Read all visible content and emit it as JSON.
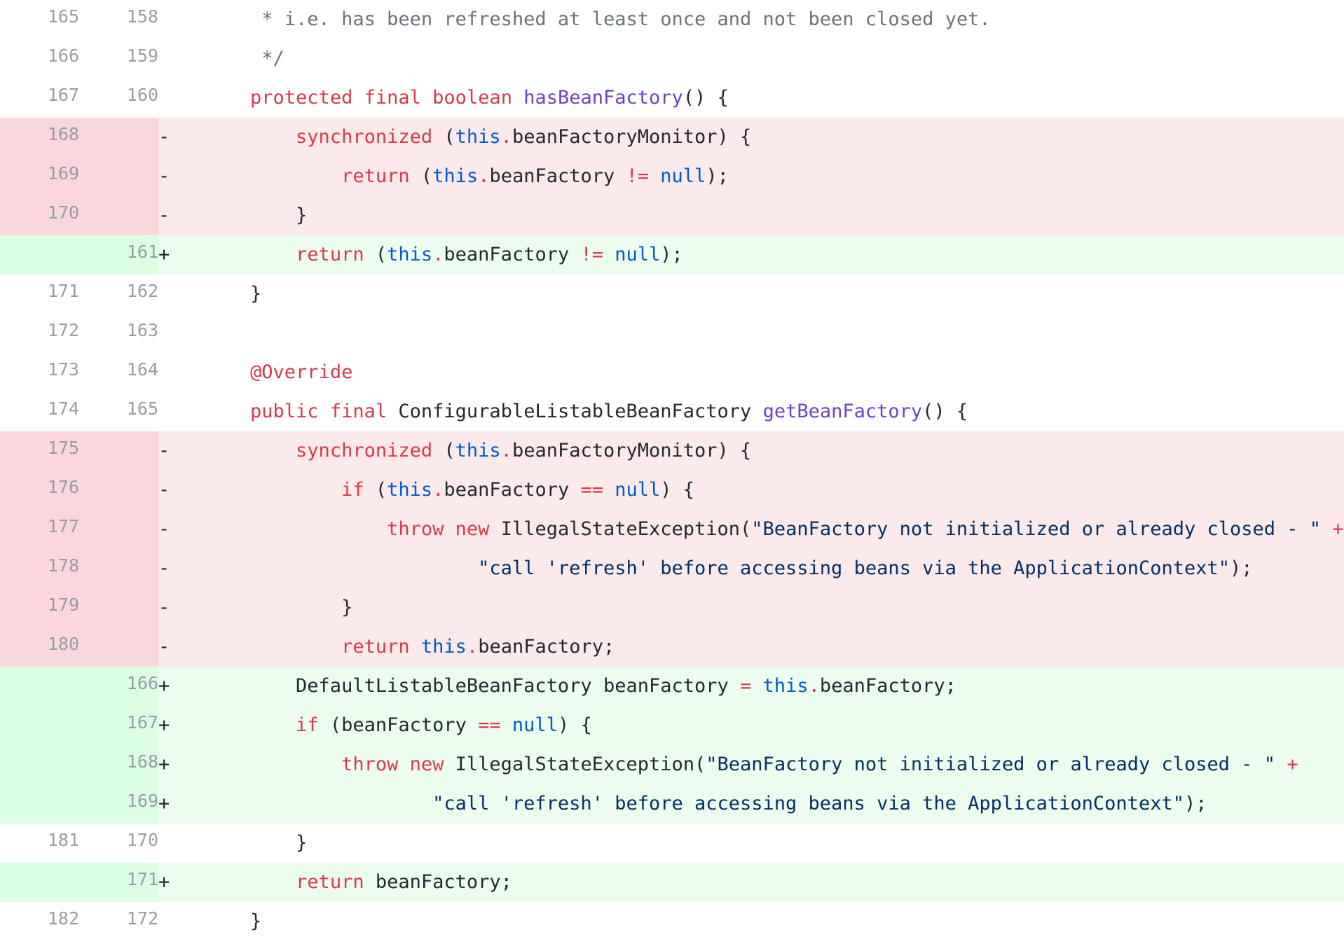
{
  "colors": {
    "background": "#ffffff",
    "line_number": "#959da5",
    "deleted_gutter": "#f9d7dc",
    "deleted_line": "#fbe9eb",
    "added_gutter": "#dcffe4",
    "added_line": "#ecfdf0",
    "keyword": "#d73a49",
    "function": "#6f42c1",
    "constant": "#005cc5",
    "string": "#032f62",
    "comment": "#6a737d",
    "text": "#24292e"
  },
  "diff": {
    "lines": [
      {
        "kind": "ctx",
        "old": "165",
        "new": "158",
        "marker": "",
        "tokens": [
          {
            "t": "cm",
            "v": "     * i.e. has been refreshed at least once and not been closed yet."
          }
        ]
      },
      {
        "kind": "ctx",
        "old": "166",
        "new": "159",
        "marker": "",
        "tokens": [
          {
            "t": "cm",
            "v": "     */"
          }
        ]
      },
      {
        "kind": "ctx",
        "old": "167",
        "new": "160",
        "marker": "",
        "tokens": [
          {
            "t": "p",
            "v": "    "
          },
          {
            "t": "kw",
            "v": "protected"
          },
          {
            "t": "p",
            "v": " "
          },
          {
            "t": "kw",
            "v": "final"
          },
          {
            "t": "p",
            "v": " "
          },
          {
            "t": "kw",
            "v": "boolean"
          },
          {
            "t": "p",
            "v": " "
          },
          {
            "t": "fn",
            "v": "hasBeanFactory"
          },
          {
            "t": "p",
            "v": "() {"
          }
        ]
      },
      {
        "kind": "del",
        "old": "168",
        "new": "",
        "marker": "-",
        "tokens": [
          {
            "t": "p",
            "v": "        "
          },
          {
            "t": "kw",
            "v": "synchronized"
          },
          {
            "t": "p",
            "v": " ("
          },
          {
            "t": "c",
            "v": "this"
          },
          {
            "t": "kw",
            "v": "."
          },
          {
            "t": "p",
            "v": "beanFactoryMonitor) {"
          }
        ]
      },
      {
        "kind": "del",
        "old": "169",
        "new": "",
        "marker": "-",
        "tokens": [
          {
            "t": "p",
            "v": "            "
          },
          {
            "t": "kw",
            "v": "return"
          },
          {
            "t": "p",
            "v": " ("
          },
          {
            "t": "c",
            "v": "this"
          },
          {
            "t": "kw",
            "v": "."
          },
          {
            "t": "p",
            "v": "beanFactory "
          },
          {
            "t": "kw",
            "v": "!="
          },
          {
            "t": "p",
            "v": " "
          },
          {
            "t": "c",
            "v": "null"
          },
          {
            "t": "p",
            "v": ");"
          }
        ]
      },
      {
        "kind": "del",
        "old": "170",
        "new": "",
        "marker": "-",
        "tokens": [
          {
            "t": "p",
            "v": "        }"
          }
        ]
      },
      {
        "kind": "add",
        "old": "",
        "new": "161",
        "marker": "+",
        "tokens": [
          {
            "t": "p",
            "v": "        "
          },
          {
            "t": "kw",
            "v": "return"
          },
          {
            "t": "p",
            "v": " ("
          },
          {
            "t": "c",
            "v": "this"
          },
          {
            "t": "kw",
            "v": "."
          },
          {
            "t": "p",
            "v": "beanFactory "
          },
          {
            "t": "kw",
            "v": "!="
          },
          {
            "t": "p",
            "v": " "
          },
          {
            "t": "c",
            "v": "null"
          },
          {
            "t": "p",
            "v": ");"
          }
        ]
      },
      {
        "kind": "ctx",
        "old": "171",
        "new": "162",
        "marker": "",
        "tokens": [
          {
            "t": "p",
            "v": "    }"
          }
        ]
      },
      {
        "kind": "ctx",
        "old": "172",
        "new": "163",
        "marker": "",
        "tokens": []
      },
      {
        "kind": "ctx",
        "old": "173",
        "new": "164",
        "marker": "",
        "tokens": [
          {
            "t": "p",
            "v": "    "
          },
          {
            "t": "kw",
            "v": "@Override"
          }
        ]
      },
      {
        "kind": "ctx",
        "old": "174",
        "new": "165",
        "marker": "",
        "tokens": [
          {
            "t": "p",
            "v": "    "
          },
          {
            "t": "kw",
            "v": "public"
          },
          {
            "t": "p",
            "v": " "
          },
          {
            "t": "kw",
            "v": "final"
          },
          {
            "t": "p",
            "v": " ConfigurableListableBeanFactory "
          },
          {
            "t": "fn",
            "v": "getBeanFactory"
          },
          {
            "t": "p",
            "v": "() {"
          }
        ]
      },
      {
        "kind": "del",
        "old": "175",
        "new": "",
        "marker": "-",
        "tokens": [
          {
            "t": "p",
            "v": "        "
          },
          {
            "t": "kw",
            "v": "synchronized"
          },
          {
            "t": "p",
            "v": " ("
          },
          {
            "t": "c",
            "v": "this"
          },
          {
            "t": "kw",
            "v": "."
          },
          {
            "t": "p",
            "v": "beanFactoryMonitor) {"
          }
        ]
      },
      {
        "kind": "del",
        "old": "176",
        "new": "",
        "marker": "-",
        "tokens": [
          {
            "t": "p",
            "v": "            "
          },
          {
            "t": "kw",
            "v": "if"
          },
          {
            "t": "p",
            "v": " ("
          },
          {
            "t": "c",
            "v": "this"
          },
          {
            "t": "kw",
            "v": "."
          },
          {
            "t": "p",
            "v": "beanFactory "
          },
          {
            "t": "kw",
            "v": "=="
          },
          {
            "t": "p",
            "v": " "
          },
          {
            "t": "c",
            "v": "null"
          },
          {
            "t": "p",
            "v": ") {"
          }
        ]
      },
      {
        "kind": "del",
        "old": "177",
        "new": "",
        "marker": "-",
        "tokens": [
          {
            "t": "p",
            "v": "                "
          },
          {
            "t": "kw",
            "v": "throw"
          },
          {
            "t": "p",
            "v": " "
          },
          {
            "t": "kw",
            "v": "new"
          },
          {
            "t": "p",
            "v": " IllegalStateException("
          },
          {
            "t": "s",
            "v": "\"BeanFactory not initialized or already closed - \""
          },
          {
            "t": "p",
            "v": " "
          },
          {
            "t": "kw",
            "v": "+"
          }
        ]
      },
      {
        "kind": "del",
        "old": "178",
        "new": "",
        "marker": "-",
        "tokens": [
          {
            "t": "p",
            "v": "                        "
          },
          {
            "t": "s",
            "v": "\"call 'refresh' before accessing beans via the ApplicationContext\""
          },
          {
            "t": "p",
            "v": ");"
          }
        ]
      },
      {
        "kind": "del",
        "old": "179",
        "new": "",
        "marker": "-",
        "tokens": [
          {
            "t": "p",
            "v": "            }"
          }
        ]
      },
      {
        "kind": "del",
        "old": "180",
        "new": "",
        "marker": "-",
        "tokens": [
          {
            "t": "p",
            "v": "            "
          },
          {
            "t": "kw",
            "v": "return"
          },
          {
            "t": "p",
            "v": " "
          },
          {
            "t": "c",
            "v": "this"
          },
          {
            "t": "kw",
            "v": "."
          },
          {
            "t": "p",
            "v": "beanFactory;"
          }
        ]
      },
      {
        "kind": "add",
        "old": "",
        "new": "166",
        "marker": "+",
        "tokens": [
          {
            "t": "p",
            "v": "        DefaultListableBeanFactory beanFactory "
          },
          {
            "t": "kw",
            "v": "="
          },
          {
            "t": "p",
            "v": " "
          },
          {
            "t": "c",
            "v": "this"
          },
          {
            "t": "kw",
            "v": "."
          },
          {
            "t": "p",
            "v": "beanFactory;"
          }
        ]
      },
      {
        "kind": "add",
        "old": "",
        "new": "167",
        "marker": "+",
        "tokens": [
          {
            "t": "p",
            "v": "        "
          },
          {
            "t": "kw",
            "v": "if"
          },
          {
            "t": "p",
            "v": " (beanFactory "
          },
          {
            "t": "kw",
            "v": "=="
          },
          {
            "t": "p",
            "v": " "
          },
          {
            "t": "c",
            "v": "null"
          },
          {
            "t": "p",
            "v": ") {"
          }
        ]
      },
      {
        "kind": "add",
        "old": "",
        "new": "168",
        "marker": "+",
        "tokens": [
          {
            "t": "p",
            "v": "            "
          },
          {
            "t": "kw",
            "v": "throw"
          },
          {
            "t": "p",
            "v": " "
          },
          {
            "t": "kw",
            "v": "new"
          },
          {
            "t": "p",
            "v": " IllegalStateException("
          },
          {
            "t": "s",
            "v": "\"BeanFactory not initialized or already closed - \""
          },
          {
            "t": "p",
            "v": " "
          },
          {
            "t": "kw",
            "v": "+"
          }
        ]
      },
      {
        "kind": "add",
        "old": "",
        "new": "169",
        "marker": "+",
        "tokens": [
          {
            "t": "p",
            "v": "                    "
          },
          {
            "t": "s",
            "v": "\"call 'refresh' before accessing beans via the ApplicationContext\""
          },
          {
            "t": "p",
            "v": ");"
          }
        ]
      },
      {
        "kind": "ctx",
        "old": "181",
        "new": "170",
        "marker": "",
        "tokens": [
          {
            "t": "p",
            "v": "        }"
          }
        ]
      },
      {
        "kind": "add",
        "old": "",
        "new": "171",
        "marker": "+",
        "tokens": [
          {
            "t": "p",
            "v": "        "
          },
          {
            "t": "kw",
            "v": "return"
          },
          {
            "t": "p",
            "v": " beanFactory;"
          }
        ]
      },
      {
        "kind": "ctx",
        "old": "182",
        "new": "172",
        "marker": "",
        "tokens": [
          {
            "t": "p",
            "v": "    }"
          }
        ]
      }
    ]
  }
}
